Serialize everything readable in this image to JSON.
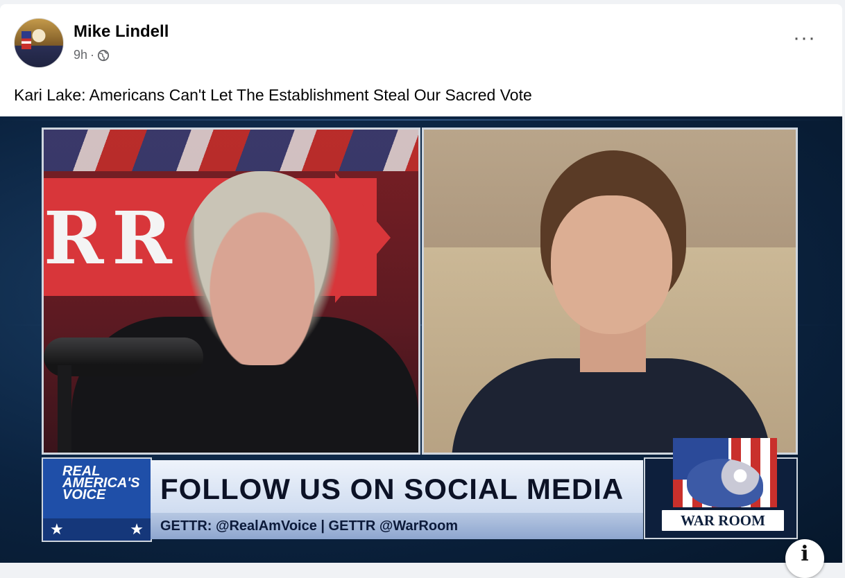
{
  "post": {
    "author": "Mike Lindell",
    "time": "9h",
    "separator": "·",
    "privacy_icon": "globe-icon",
    "more_label": "···",
    "caption": "Kari Lake: Americans Can't Let The Establishment Steal Our Sacred Vote"
  },
  "video": {
    "left_backdrop_text": "RR   I",
    "brand_lines": [
      "REAL",
      "AMERICA'S",
      "VOICE"
    ],
    "stars": [
      "★",
      "★"
    ],
    "headline": "FOLLOW US ON SOCIAL MEDIA",
    "subline": "GETTR: @RealAmVoice | GETTR @WarRoom",
    "warroom_label": "WAR ROOM",
    "info_label": "i"
  },
  "colors": {
    "background": "#f0f2f5",
    "name_text": "#050505",
    "meta_text": "#65676b",
    "banner_red": "#d8363a",
    "rav_blue": "#1f4fa8",
    "warroom_navy": "#0d1f3c"
  }
}
